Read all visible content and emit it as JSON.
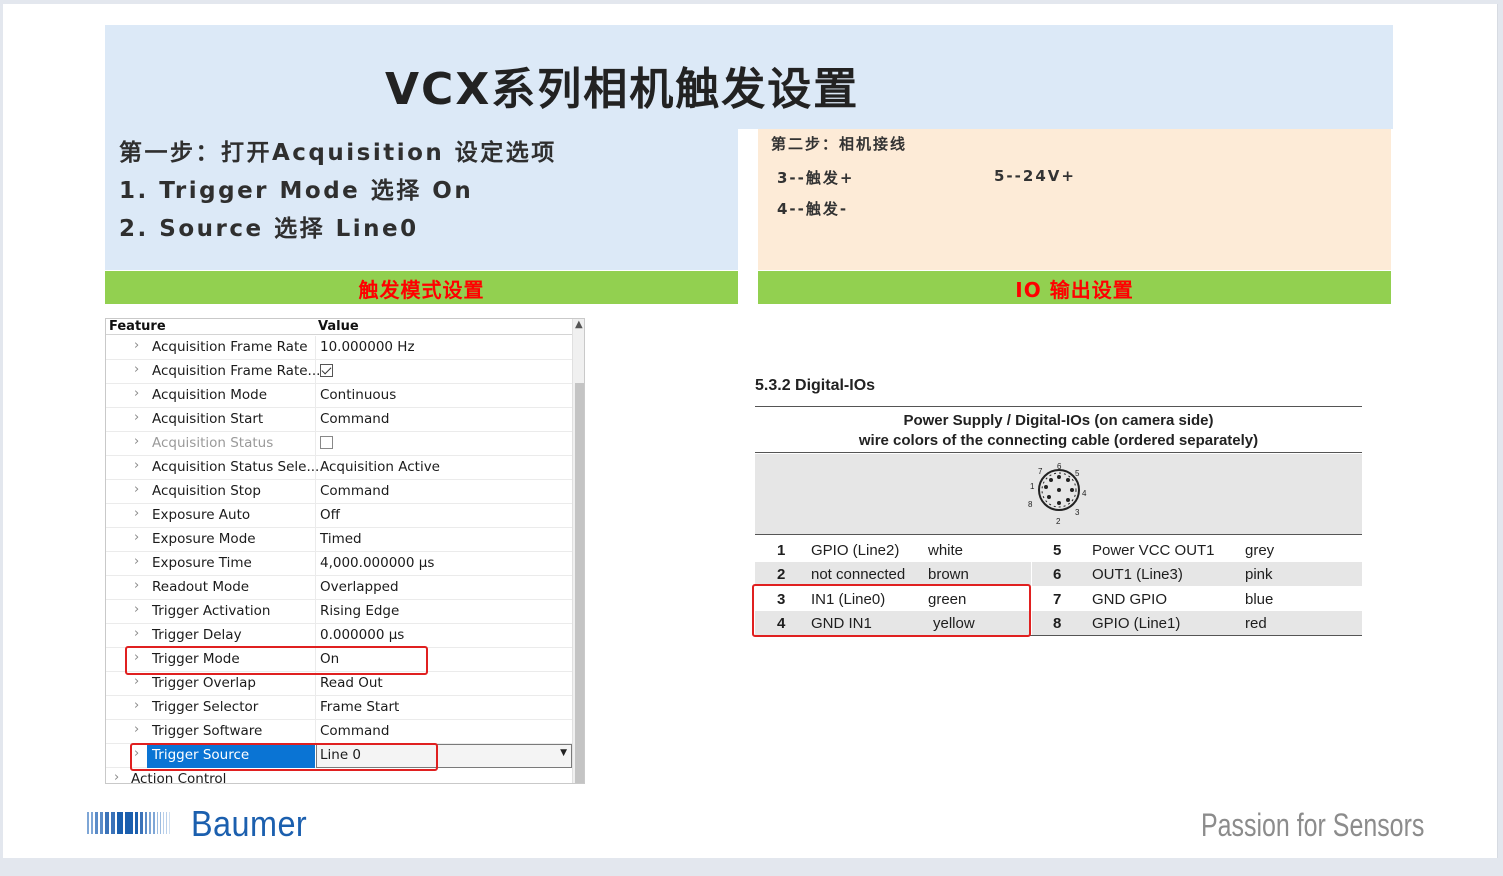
{
  "slide": {
    "title": "VCX系列相机触发设置",
    "step1": {
      "heading": "第一步：打开Acquisition 设定选项",
      "item1": "1.  Trigger Mode 选择  On",
      "item2": "2.  Source 选择 Line0"
    },
    "step2": {
      "heading": "第二步：相机接线",
      "wire3": "3--触发+",
      "wire5": "5--24V+",
      "wire4": "4--触发-"
    },
    "bar_left": "触发模式设置",
    "bar_right": "IO 输出设置"
  },
  "feature_grid": {
    "col_feature": "Feature",
    "col_value": "Value",
    "rows": [
      {
        "feature": "Acquisition Frame Rate",
        "value": "10.000000 Hz"
      },
      {
        "feature": "Acquisition Frame Rate...",
        "value": "",
        "checkbox": true
      },
      {
        "feature": "Acquisition Mode",
        "value": "Continuous"
      },
      {
        "feature": "Acquisition Start",
        "value": "Command"
      },
      {
        "feature": "Acquisition Status",
        "value": "",
        "checkbox": false,
        "disabled": true
      },
      {
        "feature": "Acquisition Status Sele...",
        "value": "Acquisition Active"
      },
      {
        "feature": "Acquisition Stop",
        "value": "Command"
      },
      {
        "feature": "Exposure Auto",
        "value": "Off"
      },
      {
        "feature": "Exposure Mode",
        "value": "Timed"
      },
      {
        "feature": "Exposure Time",
        "value": "4,000.000000 µs"
      },
      {
        "feature": "Readout Mode",
        "value": "Overlapped"
      },
      {
        "feature": "Trigger Activation",
        "value": "Rising Edge"
      },
      {
        "feature": "Trigger Delay",
        "value": "0.000000 µs"
      },
      {
        "feature": "Trigger Mode",
        "value": "On"
      },
      {
        "feature": "Trigger Overlap",
        "value": "Read Out"
      },
      {
        "feature": "Trigger Selector",
        "value": "Frame Start"
      },
      {
        "feature": "Trigger Software",
        "value": "Command"
      },
      {
        "feature": "Trigger Source",
        "value": "Line 0"
      }
    ],
    "next_group": "Action Control"
  },
  "digital_io": {
    "section": "5.3.2 Digital-IOs",
    "caption_line1": "Power Supply / Digital-IOs (on camera side)",
    "caption_line2": "wire colors of the connecting cable (ordered separately)",
    "connector_pins": [
      "1",
      "2",
      "3",
      "4",
      "5",
      "6",
      "7",
      "8"
    ],
    "rows": [
      {
        "pin_a": "1",
        "sig_a": "GPIO (Line2)",
        "col_a": "white",
        "pin_b": "5",
        "sig_b": "Power VCC OUT1",
        "col_b": "grey"
      },
      {
        "pin_a": "2",
        "sig_a": "not connected",
        "col_a": "brown",
        "pin_b": "6",
        "sig_b": "OUT1 (Line3)",
        "col_b": "pink"
      },
      {
        "pin_a": "3",
        "sig_a": "IN1 (Line0)",
        "col_a": "green",
        "pin_b": "7",
        "sig_b": "GND GPIO",
        "col_b": "blue"
      },
      {
        "pin_a": "4",
        "sig_a": "GND IN1",
        "col_a": "yellow",
        "pin_b": "8",
        "sig_b": "GPIO (Line1)",
        "col_b": "red"
      }
    ]
  },
  "footer": {
    "brand": "Baumer",
    "tagline": "Passion for Sensors"
  },
  "colors": {
    "title_band": "#dce9f7",
    "step2_band": "#fdebd7",
    "green_bar": "#92d050",
    "red_text": "#ff0000",
    "highlight_box": "#e02020",
    "selection": "#0a74d4",
    "brand_blue": "#1b5fae"
  }
}
